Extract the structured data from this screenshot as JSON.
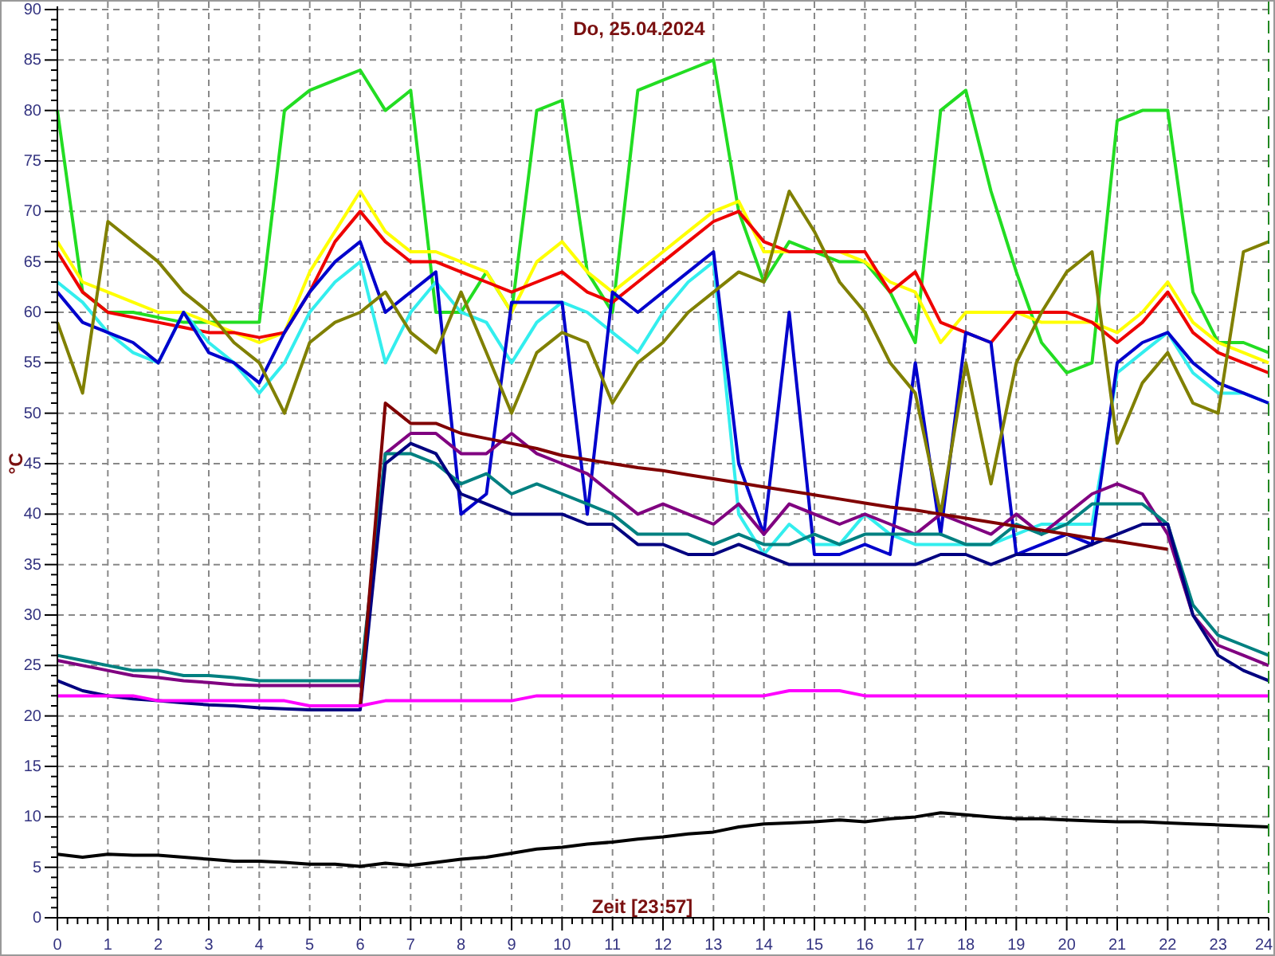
{
  "chart": {
    "chart_data": {
      "type": "line",
      "title": "Do, 25.04.2024",
      "xlabel": "Zeit [23:57]",
      "ylabel": "°C",
      "x": [
        0,
        0.5,
        1,
        1.5,
        2,
        2.5,
        3,
        3.5,
        4,
        4.5,
        5,
        5.5,
        6,
        6.5,
        7,
        7.5,
        8,
        8.5,
        9,
        9.5,
        10,
        10.5,
        11,
        11.5,
        12,
        12.5,
        13,
        13.5,
        14,
        14.5,
        15,
        15.5,
        16,
        16.5,
        17,
        17.5,
        18,
        18.5,
        19,
        19.5,
        20,
        20.5,
        21,
        21.5,
        22,
        22.5,
        23,
        23.5,
        24
      ],
      "xlim": [
        0,
        24
      ],
      "ylim": [
        0,
        90
      ],
      "grid": true,
      "xticks": [
        0,
        1,
        2,
        3,
        4,
        5,
        6,
        7,
        8,
        9,
        10,
        11,
        12,
        13,
        14,
        15,
        16,
        17,
        18,
        19,
        20,
        21,
        22,
        23,
        24
      ],
      "yticks": [
        0,
        5,
        10,
        15,
        20,
        25,
        30,
        35,
        40,
        45,
        50,
        55,
        60,
        65,
        70,
        75,
        80,
        85,
        90
      ],
      "series": [
        {
          "color": "#22dd22",
          "values": [
            80,
            62,
            60,
            60,
            59.5,
            59,
            59,
            59,
            59,
            80,
            82,
            83,
            84,
            80,
            82,
            60,
            60,
            64,
            60,
            80,
            81,
            64,
            60,
            82,
            83,
            84,
            85,
            70,
            63,
            67,
            66,
            65,
            65,
            62,
            57,
            80,
            82,
            72,
            64,
            57,
            54,
            55,
            79,
            80,
            80,
            62,
            57,
            57,
            56
          ]
        },
        {
          "color": "#ffff00",
          "values": [
            67,
            63,
            62,
            61,
            60,
            60,
            59,
            58,
            57,
            58,
            64,
            68,
            72,
            68,
            66,
            66,
            65,
            64,
            60,
            65,
            67,
            64,
            62,
            64,
            66,
            68,
            70,
            71,
            66,
            66,
            66,
            66,
            65,
            63,
            62,
            57,
            60,
            60,
            60,
            59,
            59,
            59,
            58,
            60,
            63,
            59,
            57,
            56,
            55
          ]
        },
        {
          "color": "#ee0000",
          "values": [
            66,
            62,
            60,
            59.5,
            59,
            58.5,
            58,
            58,
            57.5,
            58,
            62,
            67,
            70,
            67,
            65,
            65,
            64,
            63,
            62,
            63,
            64,
            62,
            61,
            63,
            65,
            67,
            69,
            70,
            67,
            66,
            66,
            66,
            66,
            62,
            64,
            59,
            58,
            57,
            60,
            60,
            60,
            59,
            57,
            59,
            62,
            58,
            56,
            55,
            54
          ]
        },
        {
          "color": "#33eeee",
          "values": [
            63,
            61,
            58,
            56,
            55,
            60,
            57,
            55,
            52,
            55,
            60,
            63,
            65,
            55,
            60,
            63,
            60,
            59,
            55,
            59,
            61,
            60,
            58,
            56,
            60,
            63,
            65,
            40,
            36,
            39,
            37,
            37,
            40,
            38,
            37,
            37,
            37,
            37,
            38,
            39,
            39,
            39,
            54,
            56,
            58,
            54,
            52,
            52,
            51
          ]
        },
        {
          "color": "#0000cc",
          "values": [
            62,
            59,
            58,
            57,
            55,
            60,
            56,
            55,
            53,
            58,
            62,
            65,
            67,
            60,
            62,
            64,
            40,
            42,
            61,
            61,
            61,
            40,
            62,
            60,
            62,
            64,
            66,
            45,
            38,
            60,
            36,
            36,
            37,
            36,
            55,
            38,
            58,
            57,
            36,
            37,
            38,
            37,
            55,
            57,
            58,
            55,
            53,
            52,
            51
          ]
        },
        {
          "color": "#808000",
          "values": [
            59,
            52,
            69,
            67,
            65,
            62,
            60,
            57,
            55,
            50,
            57,
            59,
            60,
            62,
            58,
            56,
            62,
            56,
            50,
            56,
            58,
            57,
            51,
            55,
            57,
            60,
            62,
            64,
            63,
            72,
            68,
            63,
            60,
            55,
            52,
            40,
            55,
            43,
            55,
            60,
            64,
            66,
            47,
            53,
            56,
            51,
            50,
            66,
            67
          ]
        },
        {
          "color": "#800080",
          "values": [
            25.5,
            25,
            24.5,
            24,
            23.8,
            23.5,
            23.3,
            23.1,
            23,
            23,
            23,
            23,
            23,
            46,
            48,
            48,
            46,
            46,
            48,
            46,
            45,
            44,
            42,
            40,
            41,
            40,
            39,
            41,
            38,
            41,
            40,
            39,
            40,
            39,
            38,
            40,
            39,
            38,
            40,
            38,
            40,
            42,
            43,
            42,
            38,
            30,
            27,
            26,
            25
          ]
        },
        {
          "color": "#008080",
          "values": [
            26,
            25.5,
            25,
            24.5,
            24.5,
            24,
            24,
            23.8,
            23.5,
            23.5,
            23.5,
            23.5,
            23.5,
            46,
            46,
            45,
            43,
            44,
            42,
            43,
            42,
            41,
            40,
            38,
            38,
            38,
            37,
            38,
            37,
            37,
            38,
            37,
            38,
            38,
            38,
            38,
            37,
            37,
            39,
            38,
            39,
            41,
            41,
            41,
            39,
            31,
            28,
            27,
            26
          ]
        },
        {
          "color": "#000080",
          "values": [
            23.5,
            22.5,
            22,
            21.7,
            21.5,
            21.3,
            21.1,
            21,
            20.8,
            20.7,
            20.6,
            20.6,
            20.6,
            45,
            47,
            46,
            42,
            41,
            40,
            40,
            40,
            39,
            39,
            37,
            37,
            36,
            36,
            37,
            36,
            35,
            35,
            35,
            35,
            35,
            35,
            36,
            36,
            35,
            36,
            36,
            36,
            37,
            38,
            39,
            39,
            30,
            26,
            24.5,
            23.5
          ]
        },
        {
          "color": "#800000",
          "values": [
            null,
            null,
            null,
            null,
            null,
            null,
            null,
            null,
            null,
            null,
            null,
            null,
            21,
            51,
            49,
            49,
            48,
            47.5,
            47,
            46.5,
            45.8,
            45.4,
            45,
            44.6,
            44.3,
            43.9,
            43.5,
            43.1,
            42.7,
            42.3,
            41.9,
            41.5,
            41.1,
            40.7,
            40.4,
            40,
            39.6,
            39.2,
            38.8,
            38.4,
            38,
            37.6,
            37.3,
            36.9,
            36.5,
            null,
            null,
            null,
            null
          ]
        },
        {
          "color": "#ff00ff",
          "values": [
            22,
            22,
            22,
            22,
            21.5,
            21.5,
            21.5,
            21.5,
            21.5,
            21.5,
            21,
            21,
            21,
            21.5,
            21.5,
            21.5,
            21.5,
            21.5,
            21.5,
            22,
            22,
            22,
            22,
            22,
            22,
            22,
            22,
            22,
            22,
            22.5,
            22.5,
            22.5,
            22,
            22,
            22,
            22,
            22,
            22,
            22,
            22,
            22,
            22,
            22,
            22,
            22,
            22,
            22,
            22,
            22
          ]
        },
        {
          "color": "#000000",
          "values": [
            6.3,
            6,
            6.3,
            6.2,
            6.2,
            6,
            5.8,
            5.6,
            5.6,
            5.5,
            5.3,
            5.3,
            5.1,
            5.4,
            5.2,
            5.5,
            5.8,
            6,
            6.4,
            6.8,
            7,
            7.3,
            7.5,
            7.8,
            8,
            8.3,
            8.5,
            9,
            9.3,
            9.4,
            9.5,
            9.7,
            9.5,
            9.8,
            10,
            10.4,
            10.2,
            10,
            9.8,
            9.8,
            9.7,
            9.6,
            9.5,
            9.5,
            9.4,
            9.3,
            9.2,
            9.1,
            9
          ]
        }
      ]
    }
  }
}
